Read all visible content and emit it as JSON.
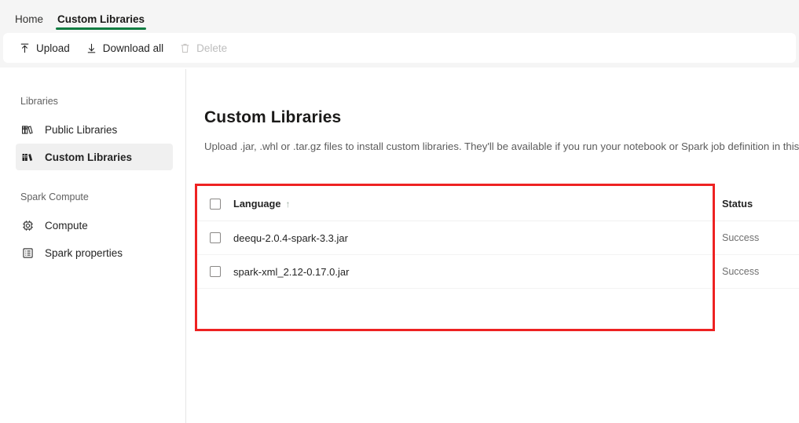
{
  "tabs": [
    {
      "label": "Home",
      "active": false
    },
    {
      "label": "Custom Libraries",
      "active": true
    }
  ],
  "toolbar": {
    "upload_label": "Upload",
    "download_all_label": "Download all",
    "delete_label": "Delete"
  },
  "sidebar": {
    "groups": [
      {
        "title": "Libraries",
        "items": [
          {
            "label": "Public Libraries",
            "icon": "books-outline-icon",
            "selected": false
          },
          {
            "label": "Custom Libraries",
            "icon": "books-filled-icon",
            "selected": true
          }
        ]
      },
      {
        "title": "Spark Compute",
        "items": [
          {
            "label": "Compute",
            "icon": "chip-icon",
            "selected": false
          },
          {
            "label": "Spark properties",
            "icon": "list-document-icon",
            "selected": false
          }
        ]
      }
    ]
  },
  "main": {
    "title": "Custom Libraries",
    "description": "Upload .jar, .whl or .tar.gz files to install custom libraries. They'll be available if you run your notebook or Spark job definition in this environment"
  },
  "table": {
    "columns": {
      "language": "Language",
      "sort_indicator": "↑",
      "status": "Status"
    },
    "rows": [
      {
        "language": "deequ-2.0.4-spark-3.3.jar",
        "status": "Success"
      },
      {
        "language": "spark-xml_2.12-0.17.0.jar",
        "status": "Success"
      }
    ]
  },
  "colors": {
    "tab_underline": "#107c41",
    "annotation_box": "#ee2222",
    "ribbon_background": "#f5f5f5",
    "selected_nav": "#f0f0f0"
  }
}
